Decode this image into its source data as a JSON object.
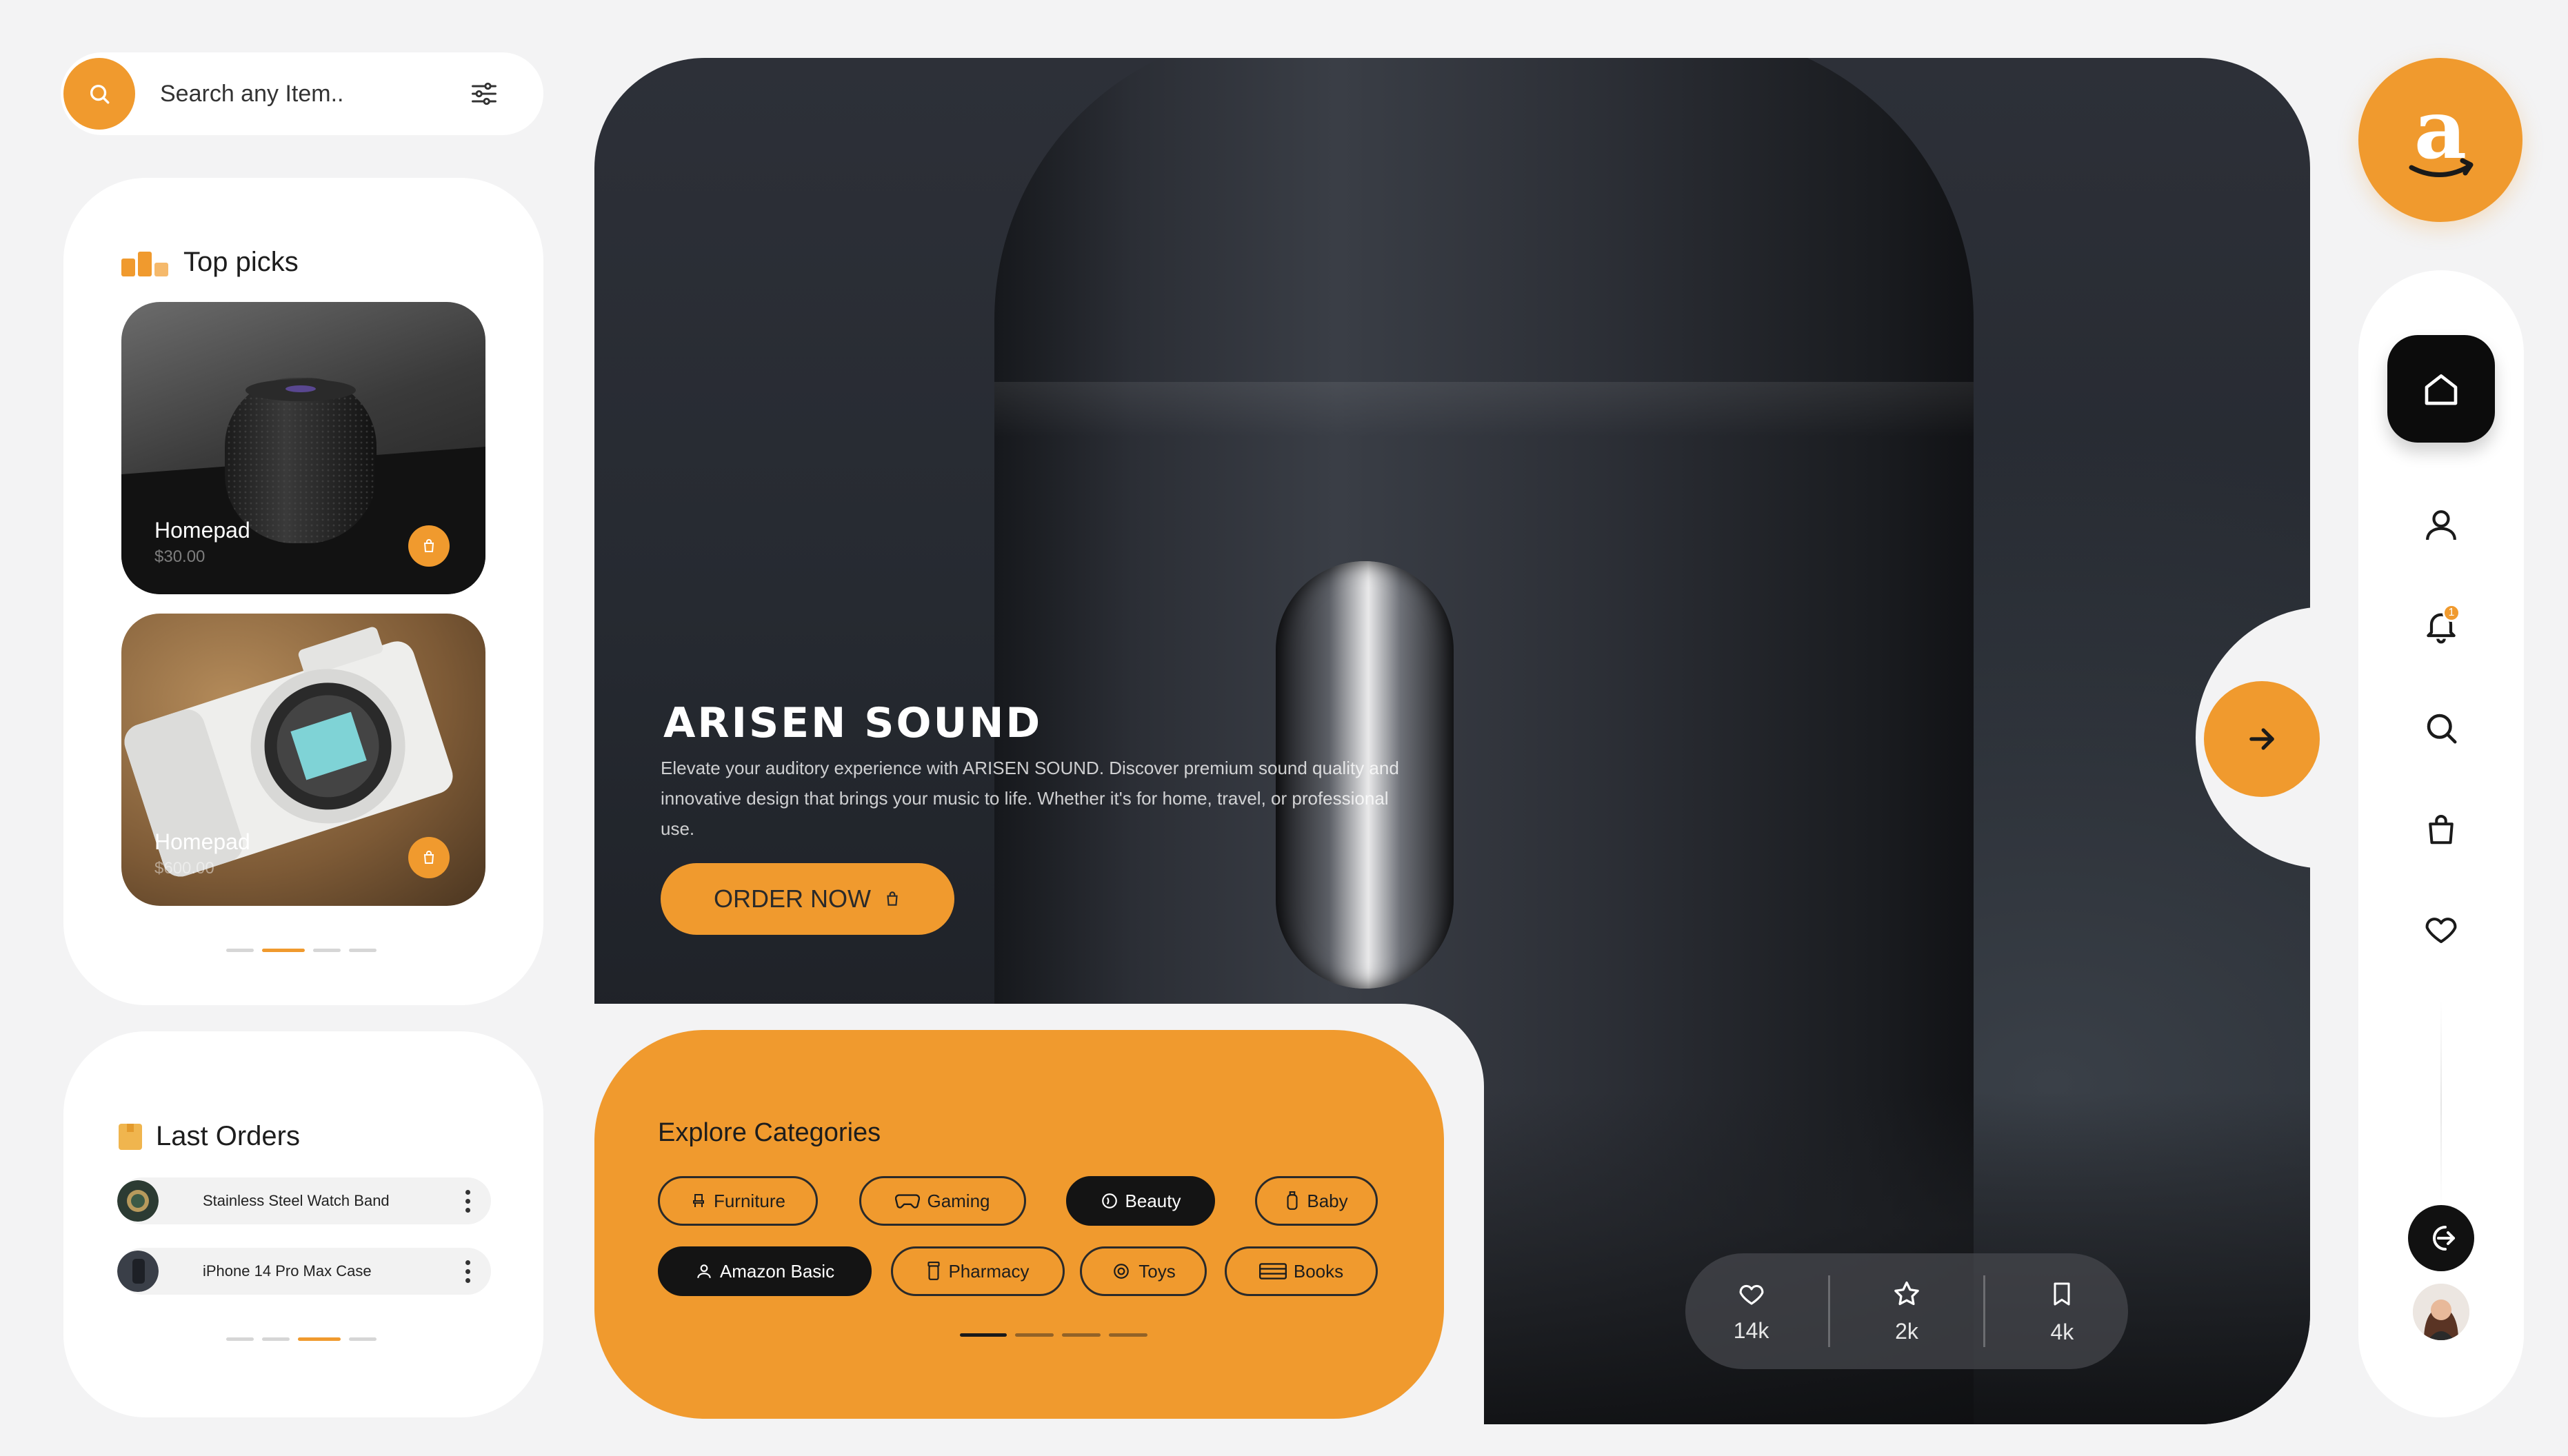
{
  "search": {
    "placeholder": "Search any Item.."
  },
  "top_picks": {
    "title": "Top picks",
    "products": [
      {
        "name": "Homepad",
        "price": "$30.00"
      },
      {
        "name": "Homepad",
        "price": "$600.00"
      }
    ]
  },
  "last_orders": {
    "title": "Last Orders",
    "items": [
      {
        "name": "Stainless Steel Watch Band"
      },
      {
        "name": "iPhone 14 Pro Max Case"
      }
    ]
  },
  "hero": {
    "title": "ARISEN SOUND",
    "description": "Elevate your auditory experience with ARISEN SOUND. Discover premium sound quality and innovative design that brings your music to life. Whether it's for home, travel, or professional use.",
    "cta_label": "ORDER NOW"
  },
  "categories": {
    "title": "Explore Categories",
    "items": [
      {
        "label": "Furniture",
        "icon": "chair-icon",
        "active": false
      },
      {
        "label": "Gaming",
        "icon": "gamepad-icon",
        "active": false
      },
      {
        "label": "Beauty",
        "icon": "beauty-icon",
        "active": true
      },
      {
        "label": "Baby",
        "icon": "baby-bottle-icon",
        "active": false
      },
      {
        "label": "Amazon Basic",
        "icon": "amazon-basic-icon",
        "active": true
      },
      {
        "label": "Pharmacy",
        "icon": "pill-bottle-icon",
        "active": false
      },
      {
        "label": "Toys",
        "icon": "toy-icon",
        "active": false
      },
      {
        "label": "Books",
        "icon": "book-icon",
        "active": false
      }
    ]
  },
  "stats": {
    "likes": "14k",
    "stars": "2k",
    "saves": "4k"
  },
  "rail": {
    "notification_count": "1"
  },
  "colors": {
    "accent": "#f09a2e",
    "dark": "#0c0c0c",
    "background": "#f3f3f4"
  }
}
